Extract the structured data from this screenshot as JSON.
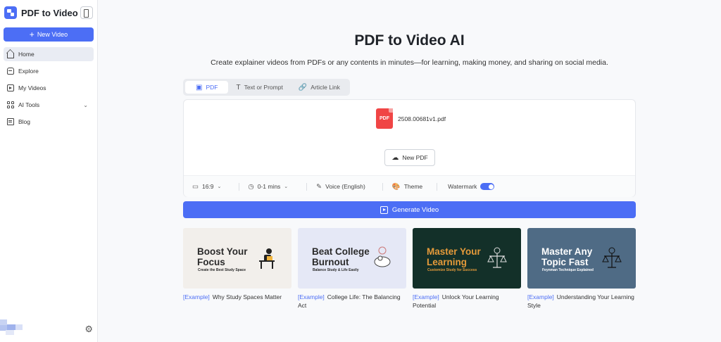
{
  "sidebar": {
    "app_name": "PDF to Video",
    "new_video_label": "New Video",
    "items": [
      {
        "label": "Home",
        "icon": "home-icon",
        "active": true
      },
      {
        "label": "Explore",
        "icon": "explore-icon"
      },
      {
        "label": "My Videos",
        "icon": "video-icon"
      },
      {
        "label": "AI Tools",
        "icon": "grid-icon",
        "expandable": true
      },
      {
        "label": "Blog",
        "icon": "blog-icon"
      }
    ]
  },
  "main": {
    "title": "PDF to Video AI",
    "subtitle": "Create explainer videos from PDFs or any contents in minutes—for learning, making money, and sharing on social media.",
    "tabs": [
      {
        "label": "PDF",
        "active": true
      },
      {
        "label": "Text or Prompt"
      },
      {
        "label": "Article Link"
      }
    ],
    "upload": {
      "file_badge": "PDF",
      "file_name": "2508.00681v1.pdf",
      "new_pdf_label": "New PDF"
    },
    "options": {
      "aspect": "16:9",
      "duration": "0-1 mins",
      "voice": "Voice (English)",
      "theme": "Theme",
      "watermark": "Watermark",
      "watermark_on": true
    },
    "generate_label": "Generate Video",
    "examples": [
      {
        "thumb_title_1": "Boost Your",
        "thumb_title_2": "Focus",
        "thumb_sub": "Create the Best Study Space",
        "tag": "[Example]",
        "caption": "Why Study Spaces Matter",
        "bg": "#f2efeb",
        "fg": "#2b2b2b"
      },
      {
        "thumb_title_1": "Beat College",
        "thumb_title_2": "Burnout",
        "thumb_sub": "Balance Study & Life Easily",
        "tag": "[Example]",
        "caption": "College Life: The Balancing Act",
        "bg": "#e5e8f6",
        "fg": "#2b2b2b"
      },
      {
        "thumb_title_1": "Master Your",
        "thumb_title_2": "Learning",
        "thumb_sub": "Customize Study for Success",
        "tag": "[Example]",
        "caption": "Unlock Your Learning Potential",
        "bg": "#133029",
        "fg": "#e59a3a"
      },
      {
        "thumb_title_1": "Master Any",
        "thumb_title_2": "Topic Fast",
        "thumb_sub": "Feynman Technique Explained",
        "tag": "[Example]",
        "caption": "Understanding Your Learning Style",
        "bg": "#4f6b85",
        "fg": "#ffffff"
      }
    ]
  }
}
